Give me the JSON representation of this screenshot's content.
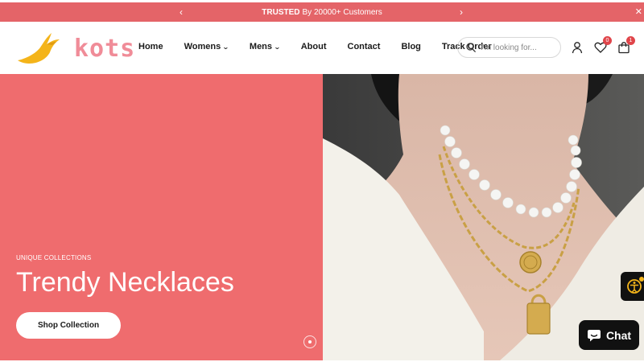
{
  "announcement": {
    "highlight": "TRUSTED",
    "text": "By 20000+ Customers",
    "prev_icon": "chevron-left-icon",
    "next_icon": "chevron-right-icon",
    "close_symbol": "✕"
  },
  "logo": {
    "text": "kots"
  },
  "nav": {
    "items": [
      {
        "label": "Home"
      },
      {
        "label": "Womens",
        "has_dropdown": true
      },
      {
        "label": "Mens",
        "has_dropdown": true
      },
      {
        "label": "About"
      },
      {
        "label": "Contact"
      },
      {
        "label": "Blog"
      },
      {
        "label": "Track Order"
      }
    ]
  },
  "search": {
    "placeholder": "I'm looking for..."
  },
  "header_icons": {
    "account": "user-icon",
    "wishlist": {
      "icon": "heart-icon",
      "count": "0"
    },
    "cart": {
      "icon": "bag-icon",
      "count": "1"
    }
  },
  "hero": {
    "kicker": "UNIQUE COLLECTIONS",
    "title": "Trendy Necklaces",
    "cta": "Shop Collection",
    "background": "#ef6c6e"
  },
  "chat": {
    "label": "Chat"
  },
  "colors": {
    "accent": "#e46468",
    "hero_bg": "#ef6c6e",
    "logo_pink": "#f08c98",
    "logo_gold": "#f4b41a",
    "badge": "#e0454a"
  }
}
